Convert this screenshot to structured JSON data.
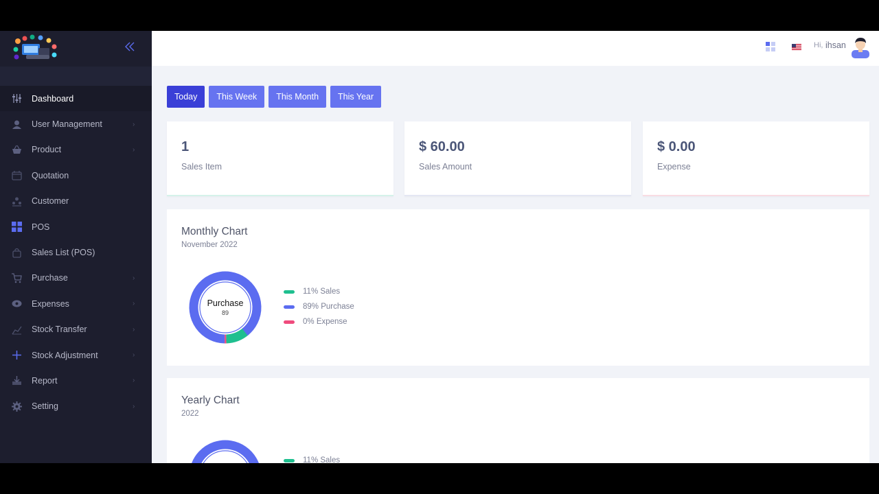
{
  "header": {
    "greeting": "Hi,",
    "username": "ihsan"
  },
  "sidebar": {
    "items": [
      {
        "label": "Dashboard",
        "icon": "sliders-icon",
        "active": true,
        "chevron": false
      },
      {
        "label": "User Management",
        "icon": "user-icon",
        "chevron": true
      },
      {
        "label": "Product",
        "icon": "basket-icon",
        "chevron": true
      },
      {
        "label": "Quotation",
        "icon": "calendar-icon",
        "chevron": false
      },
      {
        "label": "Customer",
        "icon": "customers-icon",
        "chevron": false
      },
      {
        "label": "POS",
        "icon": "pos-grid-icon",
        "chevron": false
      },
      {
        "label": "Sales List (POS)",
        "icon": "bag-icon",
        "chevron": false
      },
      {
        "label": "Purchase",
        "icon": "cart-icon",
        "chevron": true
      },
      {
        "label": "Expenses",
        "icon": "money-icon",
        "chevron": true
      },
      {
        "label": "Stock Transfer",
        "icon": "chart-icon",
        "chevron": true
      },
      {
        "label": "Stock Adjustment",
        "icon": "plus-icon",
        "chevron": true
      },
      {
        "label": "Report",
        "icon": "download-icon",
        "chevron": true
      },
      {
        "label": "Setting",
        "icon": "gear-icon",
        "chevron": true
      }
    ]
  },
  "filters": [
    "Today",
    "This Week",
    "This Month",
    "This Year"
  ],
  "stats": [
    {
      "value": "1",
      "label": "Sales Item",
      "color": "#d5f2ea"
    },
    {
      "value": "$ 60.00",
      "label": "Sales Amount",
      "color": "#e4e7f3"
    },
    {
      "value": "$ 0.00",
      "label": "Expense",
      "color": "#f9dce3"
    }
  ],
  "monthly": {
    "title": "Monthly Chart",
    "subtitle": "November 2022",
    "center_label": "Purchase",
    "center_value": "89"
  },
  "yearly": {
    "title": "Yearly Chart",
    "subtitle": "2022"
  },
  "legend": [
    {
      "label": "11% Sales",
      "color": "#1fbf8f"
    },
    {
      "label": "89% Purchase",
      "color": "#5b6cf0"
    },
    {
      "label": "0% Expense",
      "color": "#ef4b7d"
    }
  ],
  "chart_data": [
    {
      "type": "pie",
      "title": "Monthly Chart",
      "subtitle": "November 2022",
      "categories": [
        "Sales",
        "Purchase",
        "Expense"
      ],
      "values": [
        11,
        89,
        0
      ],
      "colors": [
        "#1fbf8f",
        "#5b6cf0",
        "#ef4b7d"
      ]
    },
    {
      "type": "pie",
      "title": "Yearly Chart",
      "subtitle": "2022",
      "categories": [
        "Sales"
      ],
      "values": [
        11
      ]
    }
  ],
  "colors": {
    "accent": "#6673f0",
    "accent_active": "#3a3fd7",
    "sidebar": "#1d1e2e"
  }
}
